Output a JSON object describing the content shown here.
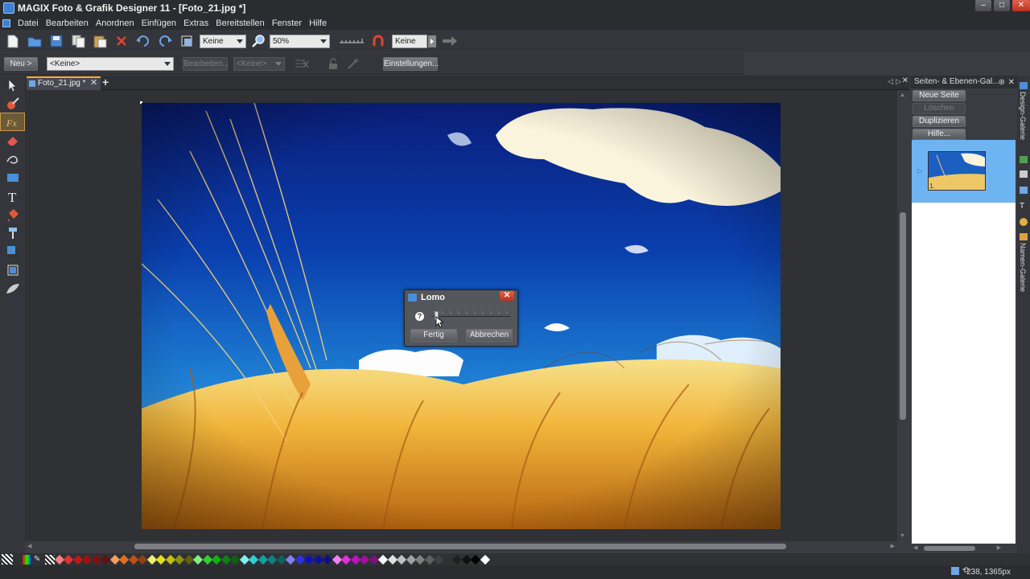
{
  "app": {
    "title": "MAGIX Foto & Grafik Designer 11 - [Foto_21.jpg *]"
  },
  "menu": [
    "Datei",
    "Bearbeiten",
    "Anordnen",
    "Einfügen",
    "Extras",
    "Bereitstellen",
    "Fenster",
    "Hilfe"
  ],
  "toolbar1": {
    "quality_select": "Keine",
    "zoom_select": "50%",
    "feather_select": "Keine"
  },
  "toolbar2": {
    "new_button": "Neu >",
    "preset_select": "<Keine>",
    "edit_button": "Bearbeiten...",
    "blend_select": "<Keine>",
    "settings_button": "Einstellungen..."
  },
  "document": {
    "tab_label": "Foto_21.jpg *"
  },
  "right_panel": {
    "title": "Seiten- & Ebenen-Gal...",
    "new_page": "Neue Seite",
    "delete": "Löschen",
    "duplicate": "Duplizieren",
    "help": "Hilfe...",
    "page_number": "1."
  },
  "side_tabs": {
    "design": "Design-Galerie",
    "names": "Namen-Galerie"
  },
  "dialog": {
    "title": "Lomo",
    "help": "?",
    "done": "Fertig",
    "cancel": "Abbrechen",
    "slider_value_fraction": 0.02
  },
  "status": {
    "coords": "-238, 1365px"
  },
  "colors": {
    "accent": "#f0b030",
    "selection": "#6fb4f2",
    "close": "#c8412a"
  }
}
